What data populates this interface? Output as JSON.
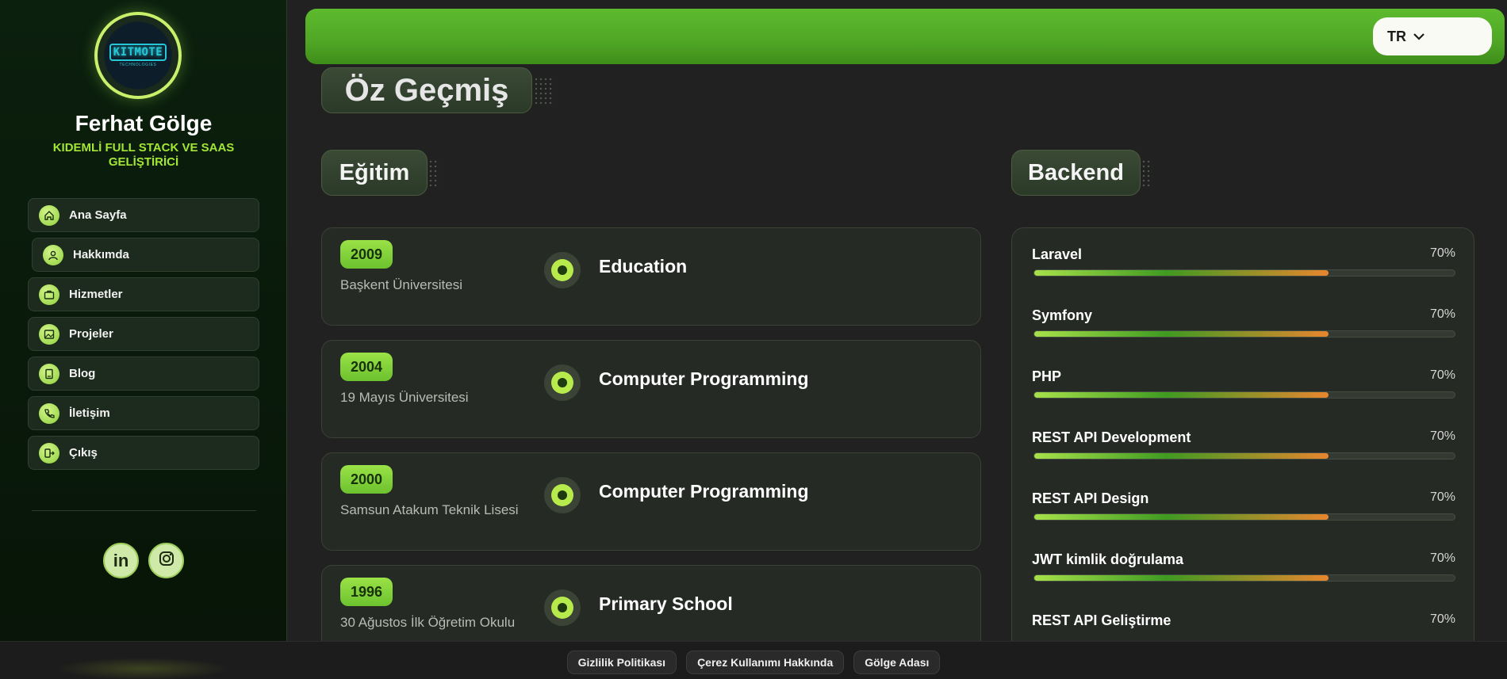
{
  "profile": {
    "logo_text": "KITMOTE",
    "logo_sub": "TECHNOLOGIES",
    "name": "Ferhat Gölge",
    "role": "KIDEMLİ FULL STACK VE SAAS GELİŞTİRİCİ"
  },
  "nav": [
    {
      "label": "Ana Sayfa",
      "icon": "home-icon"
    },
    {
      "label": "Hakkımda",
      "icon": "user-icon"
    },
    {
      "label": "Hizmetler",
      "icon": "briefcase-icon"
    },
    {
      "label": "Projeler",
      "icon": "image-icon"
    },
    {
      "label": "Blog",
      "icon": "book-icon"
    },
    {
      "label": "İletişim",
      "icon": "phone-icon"
    },
    {
      "label": "Çıkış",
      "icon": "logout-icon"
    }
  ],
  "social": {
    "linkedin": "in",
    "instagram": "instagram-icon"
  },
  "header": {
    "language": "TR"
  },
  "page_title": "Öz Geçmiş",
  "education": {
    "title": "Eğitim",
    "items": [
      {
        "year": "2009",
        "school": "Başkent Üniversitesi",
        "degree": "Education"
      },
      {
        "year": "2004",
        "school": "19 Mayıs Üniversitesi",
        "degree": "Computer Programming"
      },
      {
        "year": "2000",
        "school": "Samsun Atakum Teknik Lisesi",
        "degree": "Computer Programming"
      },
      {
        "year": "1996",
        "school": "30 Ağustos İlk Öğretim Okulu",
        "degree": "Primary School"
      }
    ]
  },
  "backend": {
    "title": "Backend",
    "skills": [
      {
        "name": "Laravel",
        "percent": "70%",
        "level": 70
      },
      {
        "name": "Symfony",
        "percent": "70%",
        "level": 70
      },
      {
        "name": "PHP",
        "percent": "70%",
        "level": 70
      },
      {
        "name": "REST API Development",
        "percent": "70%",
        "level": 70
      },
      {
        "name": "REST API Design",
        "percent": "70%",
        "level": 70
      },
      {
        "name": "JWT kimlik doğrulama",
        "percent": "70%",
        "level": 70
      },
      {
        "name": "REST API Geliştirme",
        "percent": "70%",
        "level": 70
      }
    ]
  },
  "footer": {
    "links": [
      "Gizlilik Politikası",
      "Çerez Kullanımı Hakkında",
      "Gölge Adası"
    ]
  },
  "colors": {
    "accent": "#a3e635",
    "topbar": "#4fa625",
    "background": "#212121"
  }
}
